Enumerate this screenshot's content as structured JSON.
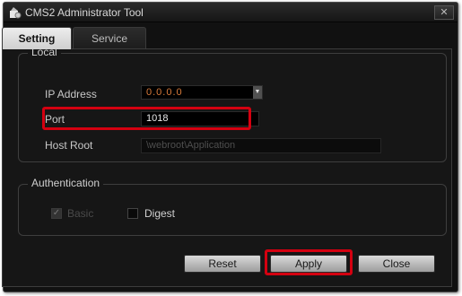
{
  "window": {
    "title": "CMS2 Administrator Tool",
    "close_symbol": "✕"
  },
  "tabs": [
    {
      "label": "Setting",
      "active": true
    },
    {
      "label": "Service",
      "active": false
    }
  ],
  "local": {
    "legend": "Local",
    "ip_address": {
      "label": "IP Address",
      "value": "0.0.0.0"
    },
    "port": {
      "label": "Port",
      "value": "1018"
    },
    "host_root": {
      "label": "Host Root",
      "value": "\\webroot\\Application"
    }
  },
  "authentication": {
    "legend": "Authentication",
    "basic": {
      "label": "Basic",
      "checked": true,
      "disabled": true
    },
    "digest": {
      "label": "Digest",
      "checked": false
    }
  },
  "buttons": {
    "reset": "Reset",
    "apply": "Apply",
    "close": "Close"
  },
  "colors": {
    "highlight": "#d40010",
    "window_bg": "#111111",
    "ip_text": "#d97a3a"
  }
}
